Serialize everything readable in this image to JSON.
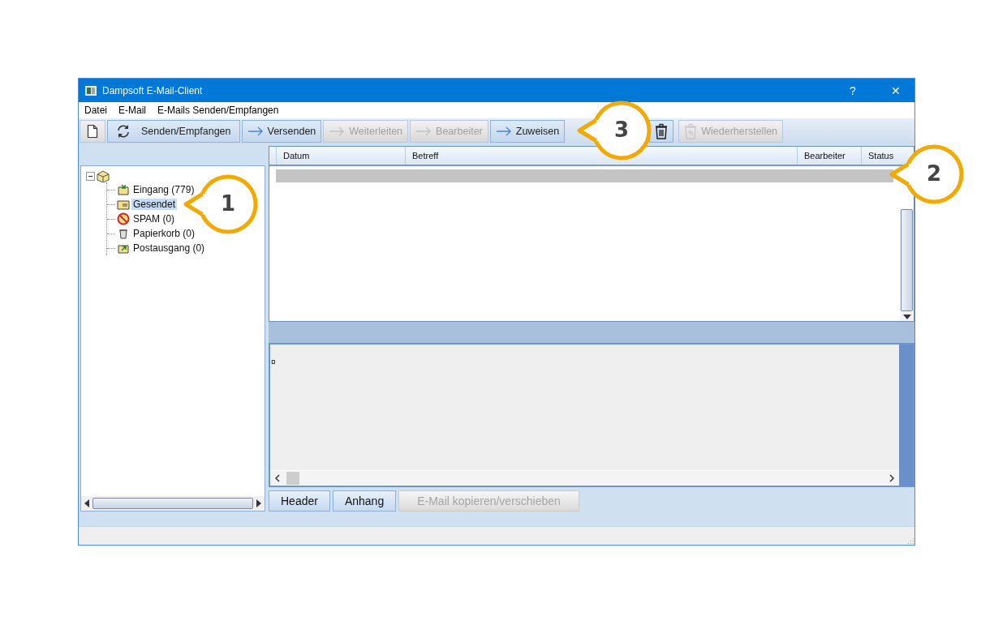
{
  "window": {
    "title": "Dampsoft E-Mail-Client",
    "controls": [
      "?",
      "✕"
    ]
  },
  "menu": [
    "Datei",
    "E-Mail",
    "E-Mails Senden/Empfangen"
  ],
  "toolbar": [
    {
      "kind": "new",
      "disabled": false,
      "pressed": false
    },
    {
      "kind": "sync",
      "label": "Senden/Empfangen",
      "disabled": false,
      "pressed": true
    },
    {
      "kind": "arrow",
      "label": "Versenden",
      "disabled": false,
      "pressed": true
    },
    {
      "kind": "arrow",
      "label": "Weiterleiten",
      "disabled": true,
      "pressed": false
    },
    {
      "kind": "arrow",
      "label": "Bearbeiter",
      "disabled": true,
      "pressed": false
    },
    {
      "kind": "arrow",
      "label": "Zuweisen",
      "disabled": false,
      "pressed": true
    },
    {
      "kind": "trash",
      "disabled": false,
      "pressed": true
    },
    {
      "kind": "restore",
      "label": "Wiederherstellen",
      "disabled": true,
      "pressed": false
    }
  ],
  "tree": {
    "expanded": true,
    "children": [
      {
        "kind": "inbox",
        "label": "Eingang (779)",
        "selected": false
      },
      {
        "kind": "sent",
        "label": "Gesendet",
        "selected": true
      },
      {
        "kind": "spam",
        "label": "SPAM (0)",
        "selected": false
      },
      {
        "kind": "trash",
        "label": "Papierkorb (0)",
        "selected": false
      },
      {
        "kind": "outbox",
        "label": "Postausgang (0)",
        "selected": false
      }
    ]
  },
  "mail_list": {
    "columns": [
      "Datum",
      "Betreff",
      "Bearbeiter",
      "Status"
    ],
    "rows": [
      {
        "selected": true
      }
    ]
  },
  "preview": {
    "text": "¤"
  },
  "bottom_buttons": [
    {
      "label": "Header",
      "disabled": false
    },
    {
      "label": "Anhang",
      "disabled": false
    },
    {
      "label": "E-Mail kopieren/verschieben",
      "disabled": true
    }
  ],
  "callouts": [
    "1",
    "2",
    "3"
  ]
}
